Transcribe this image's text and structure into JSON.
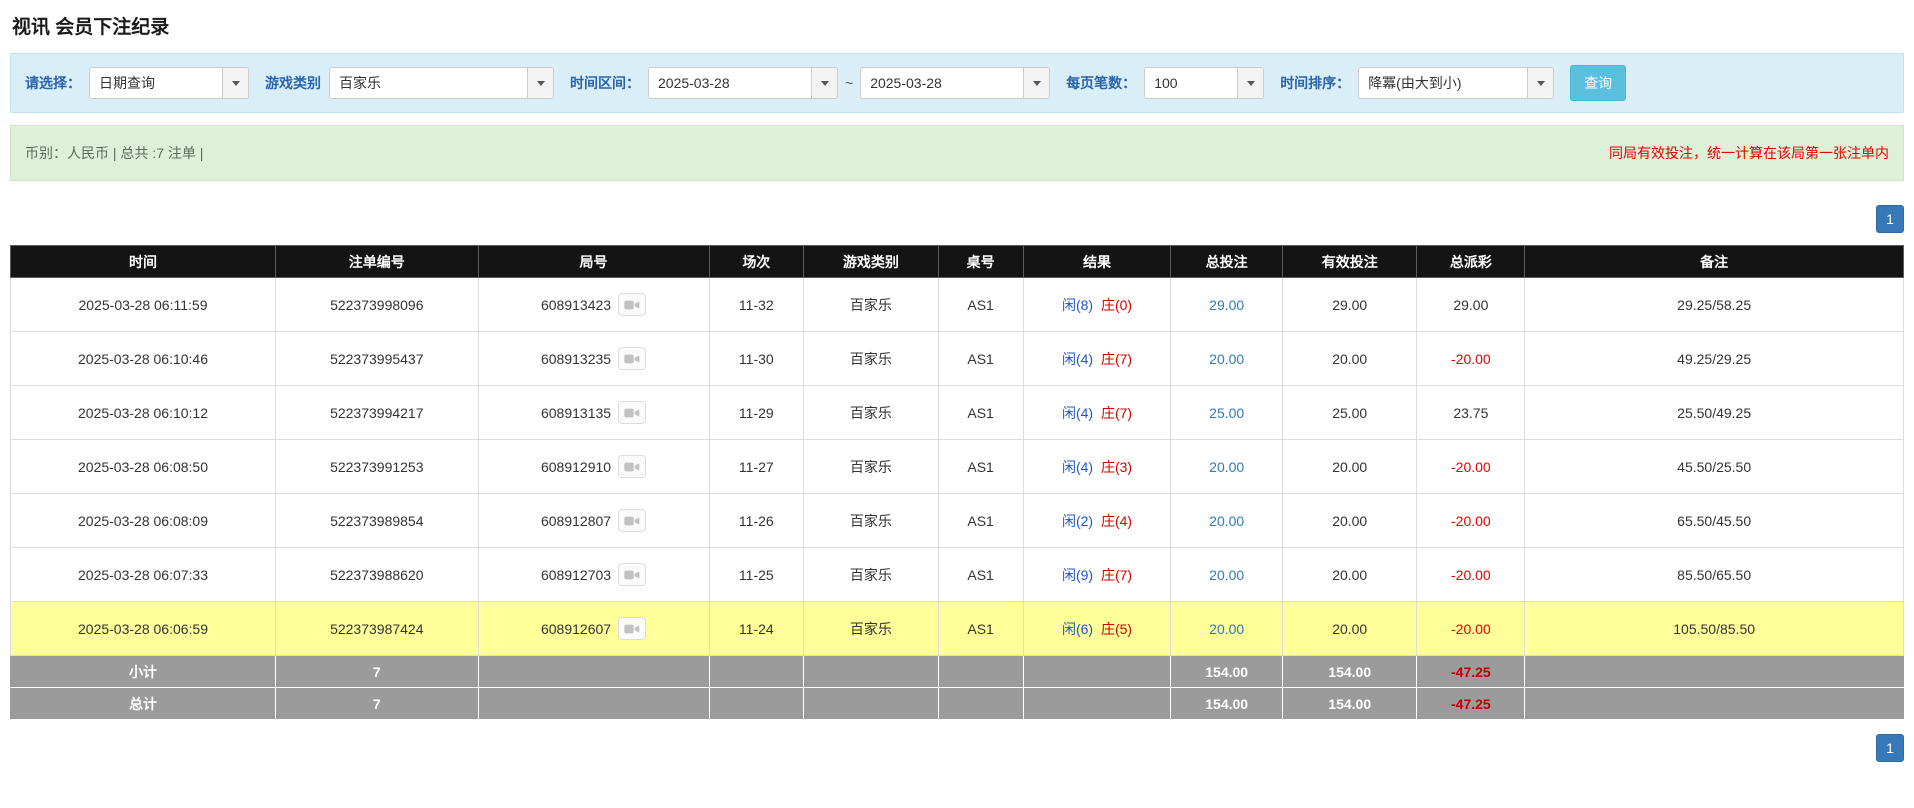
{
  "page_title": "视讯 会员下注纪录",
  "filters": {
    "query_type_label": "请选择：",
    "query_type_value": "日期查询",
    "game_type_label": "游戏类别",
    "game_type_value": "百家乐",
    "time_range_label": "时间区间：",
    "date_from": "2025-03-28",
    "date_separator": "~",
    "date_to": "2025-03-28",
    "page_size_label": "每页笔数：",
    "page_size_value": "100",
    "time_sort_label": "时间排序：",
    "time_sort_value": "降冪(由大到小)",
    "search_button_label": "查询"
  },
  "summary": {
    "left_text": "币别：人民币 | 总共 :7 注单 |",
    "right_text": "同局有效投注，统一计算在该局第一张注单内"
  },
  "pagination": {
    "current_page": "1"
  },
  "table": {
    "headers": {
      "time": "时间",
      "bet_id": "注单编号",
      "round_id": "局号",
      "session": "场次",
      "game_type": "游戏类别",
      "table_no": "桌号",
      "result": "结果",
      "total_bet": "总投注",
      "valid_bet": "有效投注",
      "total_payout": "总派彩",
      "remark": "备注"
    },
    "rows": [
      {
        "time": "2025-03-28 06:11:59",
        "bet_id": "522373998096",
        "round_id": "608913423",
        "session": "11-32",
        "game_type": "百家乐",
        "table_no": "AS1",
        "result_player": "闲(8)",
        "result_banker": "庄(0)",
        "total_bet": "29.00",
        "valid_bet": "29.00",
        "total_payout": "29.00",
        "remark": "29.25/58.25",
        "highlight": false
      },
      {
        "time": "2025-03-28 06:10:46",
        "bet_id": "522373995437",
        "round_id": "608913235",
        "session": "11-30",
        "game_type": "百家乐",
        "table_no": "AS1",
        "result_player": "闲(4)",
        "result_banker": "庄(7)",
        "total_bet": "20.00",
        "valid_bet": "20.00",
        "total_payout": "-20.00",
        "remark": "49.25/29.25",
        "highlight": false
      },
      {
        "time": "2025-03-28 06:10:12",
        "bet_id": "522373994217",
        "round_id": "608913135",
        "session": "11-29",
        "game_type": "百家乐",
        "table_no": "AS1",
        "result_player": "闲(4)",
        "result_banker": "庄(7)",
        "total_bet": "25.00",
        "valid_bet": "25.00",
        "total_payout": "23.75",
        "remark": "25.50/49.25",
        "highlight": false
      },
      {
        "time": "2025-03-28 06:08:50",
        "bet_id": "522373991253",
        "round_id": "608912910",
        "session": "11-27",
        "game_type": "百家乐",
        "table_no": "AS1",
        "result_player": "闲(4)",
        "result_banker": "庄(3)",
        "total_bet": "20.00",
        "valid_bet": "20.00",
        "total_payout": "-20.00",
        "remark": "45.50/25.50",
        "highlight": false
      },
      {
        "time": "2025-03-28 06:08:09",
        "bet_id": "522373989854",
        "round_id": "608912807",
        "session": "11-26",
        "game_type": "百家乐",
        "table_no": "AS1",
        "result_player": "闲(2)",
        "result_banker": "庄(4)",
        "total_bet": "20.00",
        "valid_bet": "20.00",
        "total_payout": "-20.00",
        "remark": "65.50/45.50",
        "highlight": false
      },
      {
        "time": "2025-03-28 06:07:33",
        "bet_id": "522373988620",
        "round_id": "608912703",
        "session": "11-25",
        "game_type": "百家乐",
        "table_no": "AS1",
        "result_player": "闲(9)",
        "result_banker": "庄(7)",
        "total_bet": "20.00",
        "valid_bet": "20.00",
        "total_payout": "-20.00",
        "remark": "85.50/65.50",
        "highlight": false
      },
      {
        "time": "2025-03-28 06:06:59",
        "bet_id": "522373987424",
        "round_id": "608912607",
        "session": "11-24",
        "game_type": "百家乐",
        "table_no": "AS1",
        "result_player": "闲(6)",
        "result_banker": "庄(5)",
        "total_bet": "20.00",
        "valid_bet": "20.00",
        "total_payout": "-20.00",
        "remark": "105.50/85.50",
        "highlight": true
      }
    ],
    "subtotal_row": {
      "label": "小计",
      "count": "7",
      "total_bet": "154.00",
      "valid_bet": "154.00",
      "total_payout": "-47.25"
    },
    "total_row": {
      "label": "总计",
      "count": "7",
      "total_bet": "154.00",
      "valid_bet": "154.00",
      "total_payout": "-47.25"
    }
  },
  "colors": {
    "accent_blue": "#337ab7",
    "negative_red": "#e60000",
    "player_blue": "#2255cc",
    "banker_red": "#d40000",
    "highlight_yellow": "#ffff99",
    "header_bg": "#141414",
    "footer_gray": "#9b9b9b",
    "filter_bg": "#d9eef7",
    "summary_bg": "#dff0d8",
    "label_blue": "#2a64ad",
    "button_info": "#5bc0de",
    "button_primary": "#3678b8"
  }
}
